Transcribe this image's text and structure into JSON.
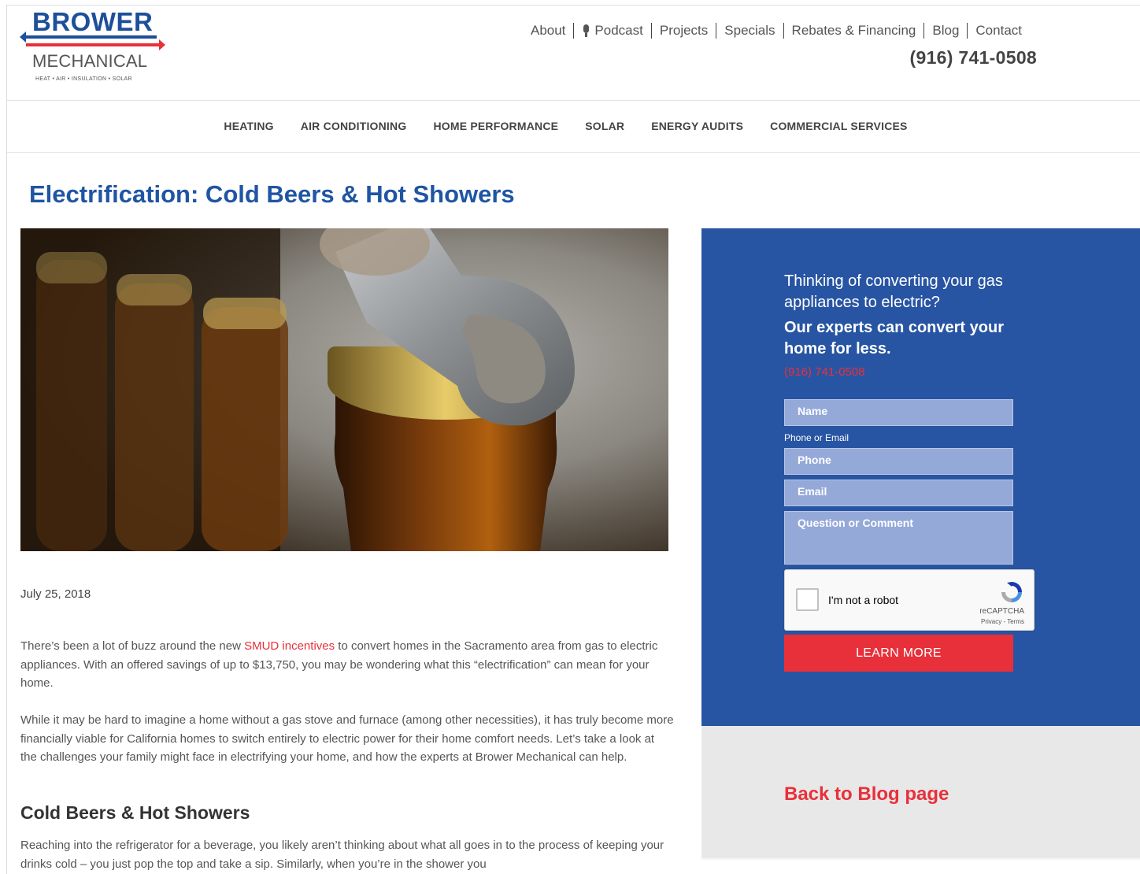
{
  "logo": {
    "word1": "BROWER",
    "word2": "MECHANICAL",
    "tagline": "HEAT • AIR • INSULATION • SOLAR"
  },
  "topnav": {
    "items": [
      "About",
      "Podcast",
      "Projects",
      "Specials",
      "Rebates & Financing",
      "Blog",
      "Contact"
    ],
    "phone": "(916) 741-0508"
  },
  "mainnav": {
    "items": [
      "HEATING",
      "AIR CONDITIONING",
      "HOME PERFORMANCE",
      "SOLAR",
      "ENERGY AUDITS",
      "COMMERCIAL SERVICES"
    ]
  },
  "article": {
    "title": "Electrification: Cold Beers & Hot Showers",
    "date": "July 25, 2018",
    "p1_before": "There’s been a lot of buzz around the new ",
    "p1_link": "SMUD incentives",
    "p1_after": " to convert homes in the Sacramento area from gas to electric appliances. With an offered savings of up to $13,750, you may be wondering what this “electrification” can mean for your home.",
    "p2": "While it may be hard to imagine a home without a gas stove and furnace (among other necessities), it has truly become more financially viable for California homes to switch entirely to electric power for their home comfort needs. Let’s take a look at the challenges your family might face in electrifying your home, and how the experts at Brower Mechanical can help.",
    "subheading": "Cold Beers & Hot Showers",
    "p3": "Reaching into the refrigerator for a beverage, you likely aren’t thinking about what all goes in to the process of keeping your drinks cold – you just pop the top and take a sip. Similarly, when you’re in the shower you"
  },
  "sidebar": {
    "cta_line1": "Thinking of converting your gas appliances to electric?",
    "cta_line2": "Our experts can convert your home for less.",
    "phone": "(916) 741-0508",
    "form": {
      "name_placeholder": "Name",
      "contact_label": "Phone or Email",
      "phone_placeholder": "Phone",
      "email_placeholder": "Email",
      "comment_placeholder": "Question or Comment",
      "submit_label": "LEARN MORE"
    },
    "recaptcha": {
      "label": "I'm not a robot",
      "brand": "reCAPTCHA",
      "links": "Privacy - Terms"
    },
    "back_link": "Back to Blog page"
  },
  "colors": {
    "brand_blue": "#2855a3",
    "title_blue": "#1f55a3",
    "accent_red": "#e8303a"
  }
}
